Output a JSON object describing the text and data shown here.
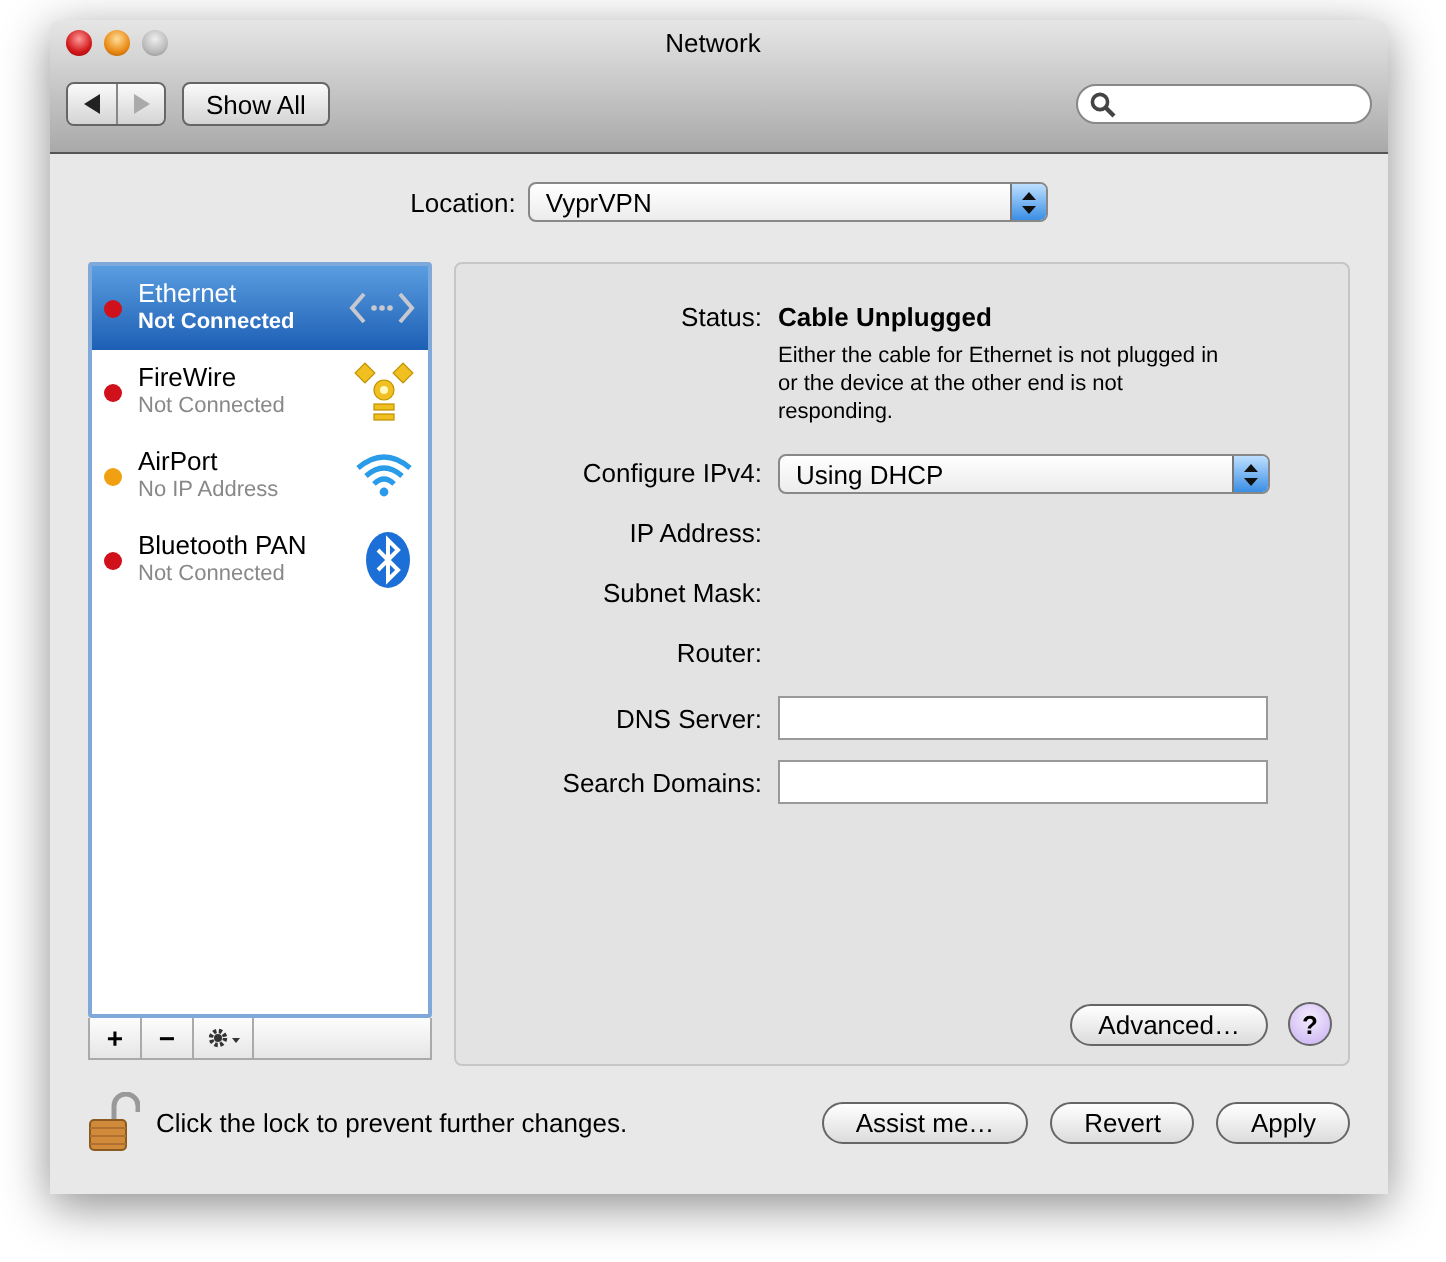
{
  "window": {
    "title": "Network"
  },
  "toolbar": {
    "show_all": "Show All",
    "back_disabled": false,
    "forward_disabled": true
  },
  "location": {
    "label": "Location:",
    "value": "VyprVPN"
  },
  "services": [
    {
      "name": "Ethernet",
      "status": "Not Connected",
      "color": "#d0101a",
      "kind": "ethernet",
      "selected": true
    },
    {
      "name": "FireWire",
      "status": "Not Connected",
      "color": "#d0101a",
      "kind": "firewire",
      "selected": false
    },
    {
      "name": "AirPort",
      "status": "No IP Address",
      "color": "#f0a010",
      "kind": "wifi",
      "selected": false
    },
    {
      "name": "Bluetooth PAN",
      "status": "Not Connected",
      "color": "#d0101a",
      "kind": "bluetooth",
      "selected": false
    }
  ],
  "list_buttons": [
    {
      "label": "+",
      "kind": "text"
    },
    {
      "label": "−",
      "kind": "text"
    },
    {
      "kind": "gear"
    }
  ],
  "detail": {
    "rows": [
      {
        "kind": "status",
        "label": "Status:",
        "value": "Cable Unplugged",
        "note": "Either the cable for Ethernet is not plugged in or the device at the other end is not responding."
      },
      {
        "kind": "popup",
        "label": "Configure IPv4:",
        "value": "Using DHCP"
      },
      {
        "kind": "empty",
        "label": "IP Address:"
      },
      {
        "kind": "empty",
        "label": "Subnet Mask:"
      },
      {
        "kind": "empty",
        "label": "Router:"
      },
      {
        "kind": "input",
        "label": "DNS Server:"
      },
      {
        "kind": "input",
        "label": "Search Domains:"
      }
    ],
    "advanced": "Advanced…",
    "help": "?"
  },
  "footer": {
    "lock_text": "Click the lock to prevent further changes.",
    "buttons": [
      "Assist me…",
      "Revert",
      "Apply"
    ]
  }
}
